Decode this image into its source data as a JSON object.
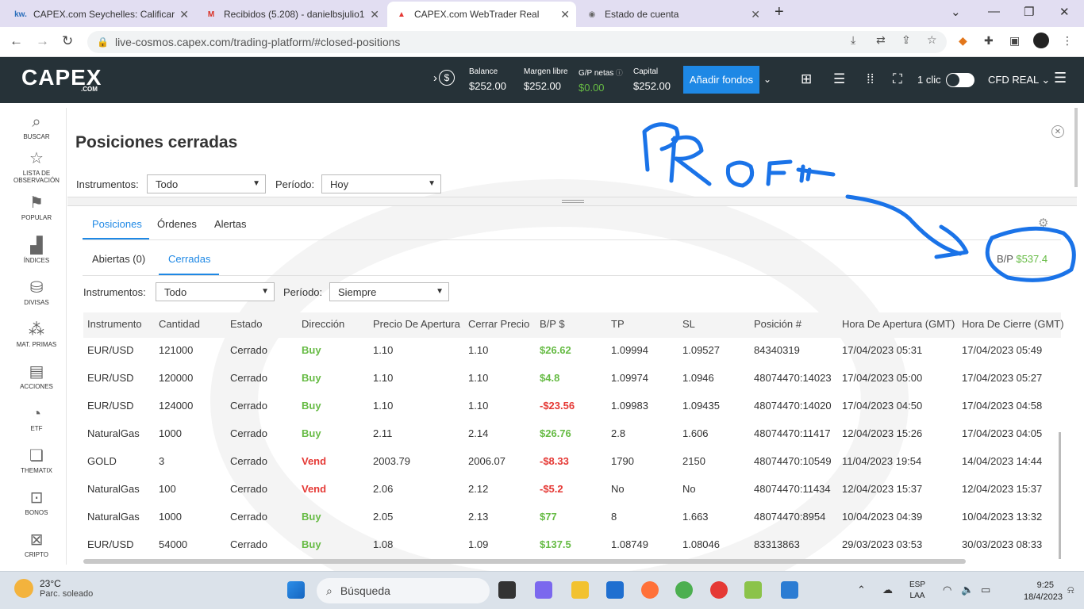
{
  "browser": {
    "tabs": [
      {
        "title": "CAPEX.com Seychelles: Calificar s",
        "icon": "kw",
        "icon_color": "#2a6ebb"
      },
      {
        "title": "Recibidos (5.208) - danielbsjulio1",
        "icon": "M",
        "icon_color": "#d93025"
      },
      {
        "title": "CAPEX.com WebTrader Real",
        "icon": "▲",
        "icon_color": "#e53935"
      },
      {
        "title": "Estado de cuenta",
        "icon": "●",
        "icon_color": "#666"
      }
    ],
    "url": "live-cosmos.capex.com/trading-platform/#closed-positions"
  },
  "header": {
    "logo": "CAPEX",
    "logo_sub": ".COM",
    "balance_label": "Balance",
    "balance_value": "$252.00",
    "margin_label": "Margen libre",
    "margin_value": "$252.00",
    "pnl_label": "G/P netas",
    "pnl_value": "$0.00",
    "capital_label": "Capital",
    "capital_value": "$252.00",
    "add_funds": "Añadir fondos",
    "one_click": "1 clic",
    "account": "CFD REAL"
  },
  "sidebar": {
    "items": [
      {
        "label": "BUSCAR",
        "icon": "search-icon"
      },
      {
        "label": "LISTA DE OBSERVACIÓN",
        "icon": "star-icon"
      },
      {
        "label": "POPULAR",
        "icon": "flag-icon"
      },
      {
        "label": "ÍNDICES",
        "icon": "chart-icon"
      },
      {
        "label": "DIVISAS",
        "icon": "coins-icon"
      },
      {
        "label": "MAT. PRIMAS",
        "icon": "commodities-icon"
      },
      {
        "label": "ACCIONES",
        "icon": "document-icon"
      },
      {
        "label": "ETF",
        "icon": "pie-icon"
      },
      {
        "label": "THEMATIX",
        "icon": "layers-icon"
      },
      {
        "label": "BONOS",
        "icon": "bond-icon"
      },
      {
        "label": "CRIPTO",
        "icon": "crypto-icon"
      }
    ]
  },
  "panel": {
    "title": "Posiciones cerradas",
    "instr_label": "Instrumentos:",
    "instr_value": "Todo",
    "period_label": "Período:",
    "period_value": "Hoy"
  },
  "tabs": {
    "positions": "Posiciones",
    "orders": "Órdenes",
    "alerts": "Alertas"
  },
  "subtabs": {
    "open": "Abiertas (0)",
    "closed": "Cerradas"
  },
  "bp_total": {
    "label": "B/P",
    "value": "$537.4"
  },
  "filters2": {
    "instr_label": "Instrumentos:",
    "instr_value": "Todo",
    "period_label": "Período:",
    "period_value": "Siempre"
  },
  "table": {
    "columns": [
      "Instrumento",
      "Cantidad",
      "Estado",
      "Dirección",
      "Precio De Apertura",
      "Cerrar Precio",
      "B/P $",
      "TP",
      "SL",
      "Posición #",
      "Hora De Apertura (GMT)",
      "Hora De Cierre (GMT)"
    ],
    "rows": [
      {
        "instrument": "EUR/USD",
        "qty": "121000",
        "status": "Cerrado",
        "dir": "Buy",
        "open": "1.10",
        "close": "1.10",
        "pl": "$26.62",
        "pl_sign": "pos",
        "tp": "1.09994",
        "sl": "1.09527",
        "pos": "84340319",
        "open_time": "17/04/2023 05:31",
        "close_time": "17/04/2023 05:49"
      },
      {
        "instrument": "EUR/USD",
        "qty": "120000",
        "status": "Cerrado",
        "dir": "Buy",
        "open": "1.10",
        "close": "1.10",
        "pl": "$4.8",
        "pl_sign": "pos",
        "tp": "1.09974",
        "sl": "1.0946",
        "pos": "48074470:14023",
        "open_time": "17/04/2023 05:00",
        "close_time": "17/04/2023 05:27"
      },
      {
        "instrument": "EUR/USD",
        "qty": "124000",
        "status": "Cerrado",
        "dir": "Buy",
        "open": "1.10",
        "close": "1.10",
        "pl": "-$23.56",
        "pl_sign": "neg",
        "tp": "1.09983",
        "sl": "1.09435",
        "pos": "48074470:14020",
        "open_time": "17/04/2023 04:50",
        "close_time": "17/04/2023 04:58"
      },
      {
        "instrument": "NaturalGas",
        "qty": "1000",
        "status": "Cerrado",
        "dir": "Buy",
        "open": "2.11",
        "close": "2.14",
        "pl": "$26.76",
        "pl_sign": "pos",
        "tp": "2.8",
        "sl": "1.606",
        "pos": "48074470:11417",
        "open_time": "12/04/2023 15:26",
        "close_time": "17/04/2023 04:05"
      },
      {
        "instrument": "GOLD",
        "qty": "3",
        "status": "Cerrado",
        "dir": "Vend",
        "open": "2003.79",
        "close": "2006.07",
        "pl": "-$8.33",
        "pl_sign": "neg",
        "tp": "1790",
        "sl": "2150",
        "pos": "48074470:10549",
        "open_time": "11/04/2023 19:54",
        "close_time": "14/04/2023 14:44"
      },
      {
        "instrument": "NaturalGas",
        "qty": "100",
        "status": "Cerrado",
        "dir": "Vend",
        "open": "2.06",
        "close": "2.12",
        "pl": "-$5.2",
        "pl_sign": "neg",
        "tp": "No",
        "sl": "No",
        "pos": "48074470:11434",
        "open_time": "12/04/2023 15:37",
        "close_time": "12/04/2023 15:37"
      },
      {
        "instrument": "NaturalGas",
        "qty": "1000",
        "status": "Cerrado",
        "dir": "Buy",
        "open": "2.05",
        "close": "2.13",
        "pl": "$77",
        "pl_sign": "pos",
        "tp": "8",
        "sl": "1.663",
        "pos": "48074470:8954",
        "open_time": "10/04/2023 04:39",
        "close_time": "10/04/2023 13:32"
      },
      {
        "instrument": "EUR/USD",
        "qty": "54000",
        "status": "Cerrado",
        "dir": "Buy",
        "open": "1.08",
        "close": "1.09",
        "pl": "$137.5",
        "pl_sign": "pos",
        "tp": "1.08749",
        "sl": "1.08046",
        "pos": "83313863",
        "open_time": "29/03/2023 03:53",
        "close_time": "30/03/2023 08:33"
      }
    ]
  },
  "taskbar": {
    "temp": "23°C",
    "weather": "Parc. soleado",
    "search": "Búsqueda",
    "lang1": "ESP",
    "lang2": "LAA",
    "time": "9:25",
    "date": "18/4/2023"
  },
  "colors": {
    "header_bg": "#263238",
    "accent": "#1e88e5",
    "positive": "#66bb44",
    "negative": "#e53935",
    "annotation": "#1a73e8"
  }
}
